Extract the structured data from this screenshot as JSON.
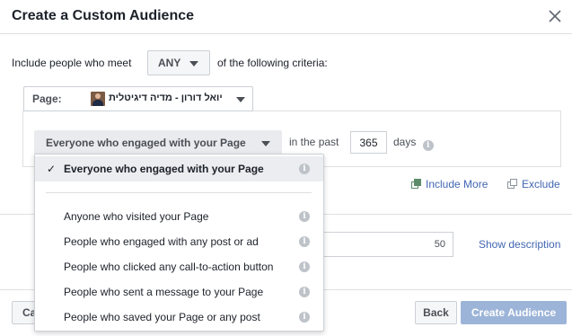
{
  "dialog": {
    "title": "Create a Custom Audience",
    "close_icon": "close-icon"
  },
  "criteria": {
    "prefix": "Include people who meet",
    "match_value": "ANY",
    "suffix": "of the following criteria:"
  },
  "page_select": {
    "label": "Page:",
    "page_name": "יואל דורון - מדיה דיגיטלית"
  },
  "engagement": {
    "selected": "Everyone who engaged with your Page",
    "in_the_past": "in the past",
    "days_value": "365",
    "days_label": "days"
  },
  "links": {
    "include_more": "Include More",
    "exclude": "Exclude",
    "show_description": "Show description"
  },
  "audience_name": {
    "char_count": "50"
  },
  "dropdown": {
    "selected_item": "Everyone who engaged with your Page",
    "items": [
      "Anyone who visited your Page",
      "People who engaged with any post or ad",
      "People who clicked any call-to-action button",
      "People who sent a message to your Page",
      "People who saved your Page or any post"
    ]
  },
  "footer": {
    "cancel_label": "Cancel",
    "back_label": "Back",
    "create_label": "Create Audience"
  },
  "colors": {
    "link": "#4267b2",
    "create_button": "#9cb4d8",
    "border": "#dddfe2"
  }
}
